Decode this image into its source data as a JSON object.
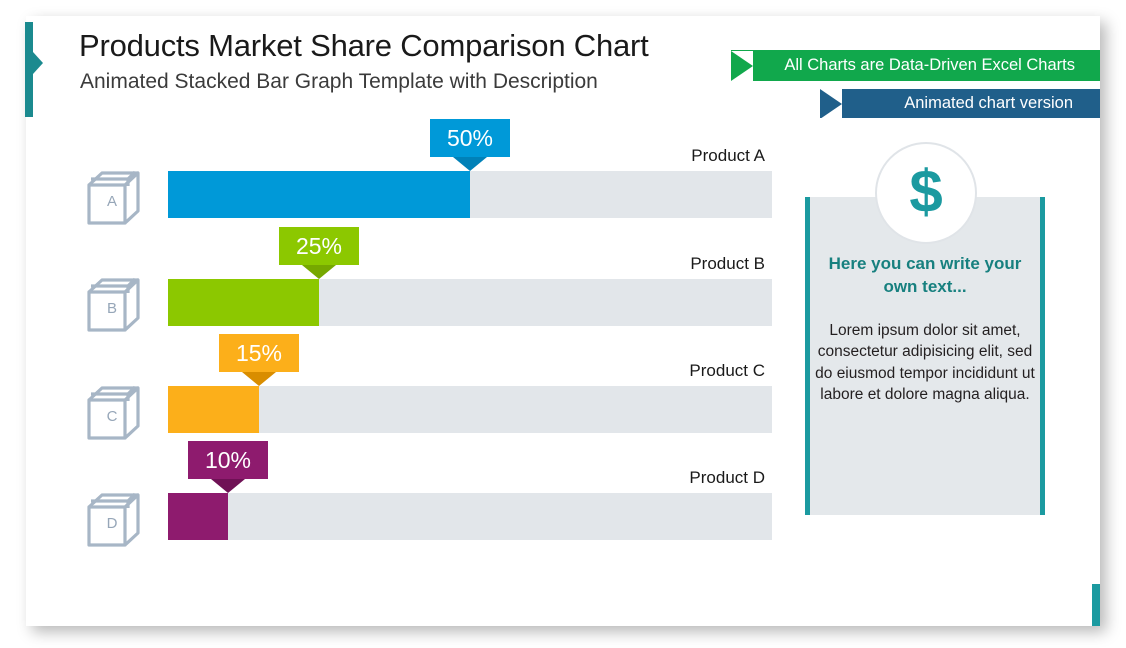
{
  "header": {
    "title": "Products Market Share Comparison Chart",
    "subtitle": "Animated Stacked Bar Graph Template with Description"
  },
  "ribbons": {
    "green": {
      "label": "All Charts are Data-Driven Excel Charts",
      "color": "#11a84c"
    },
    "blue": {
      "label": "Animated chart version",
      "color": "#205f8a"
    }
  },
  "side_panel": {
    "icon": "dollar-sign",
    "icon_glyph": "$",
    "heading": "Here you can write your own text...",
    "body": "Lorem ipsum dolor sit amet, consectetur adipisicing elit, sed do eiusmod tempor incididunt ut labore et dolore magna aliqua.",
    "accent_color": "#1b9aa0",
    "fill_color": "#e4e8eb"
  },
  "chart_data": {
    "type": "bar",
    "title": "Products Market Share Comparison Chart",
    "xlabel": "",
    "ylabel": "",
    "xlim": [
      0,
      100
    ],
    "grid": false,
    "legend": "none",
    "orientation": "horizontal",
    "track_color": "#e2e6ea",
    "categories": [
      "Product A",
      "Product B",
      "Product C",
      "Product D"
    ],
    "values": [
      50,
      25,
      15,
      10
    ],
    "data_labels": [
      "50%",
      "25%",
      "15%",
      "10%"
    ],
    "box_letters": [
      "A",
      "B",
      "C",
      "D"
    ],
    "colors": [
      "#0099d8",
      "#8cc800",
      "#fcaf1a",
      "#8e1b6e"
    ],
    "tip_colors": [
      "#0081b8",
      "#76a800",
      "#d98d00",
      "#6f1155"
    ]
  }
}
